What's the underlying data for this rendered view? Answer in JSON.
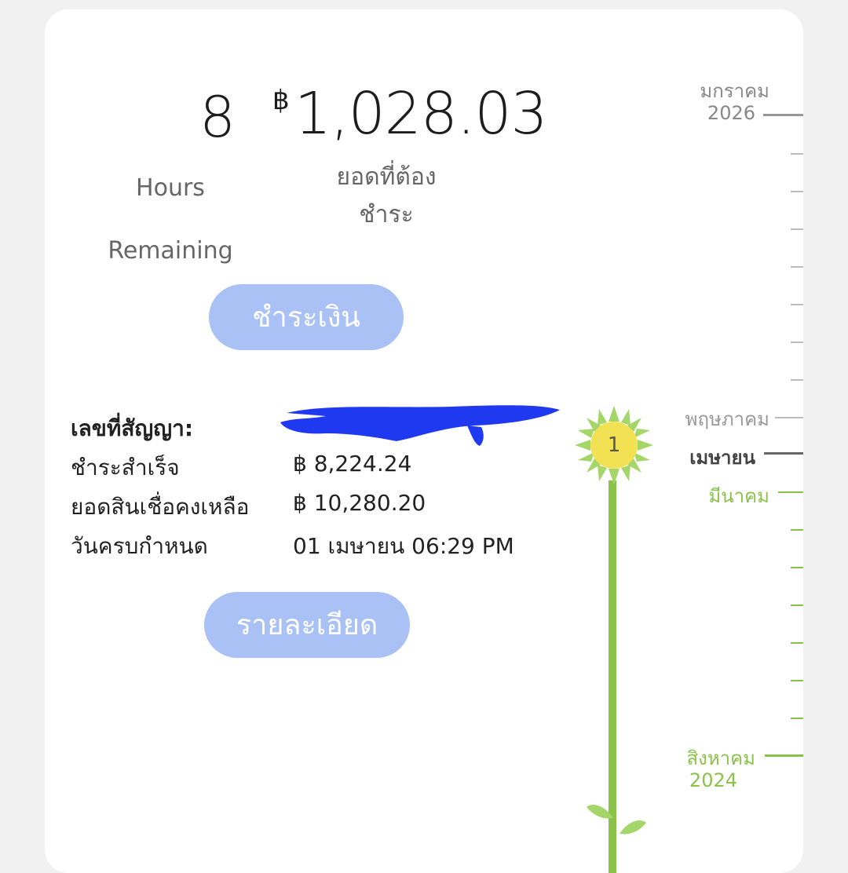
{
  "countdown": {
    "value": "8",
    "label": "Hours\nRemaining"
  },
  "due": {
    "currency": "฿",
    "amount": "1,028.03",
    "label": "ยอดที่ต้อง\nชำระ"
  },
  "buttons": {
    "pay": "ชำระเงิน",
    "details": "รายละเอียด"
  },
  "info": {
    "contract_label": "เลขที่สัญญา:",
    "paid_label": "ชำระสำเร็จ",
    "paid_value": "฿ 8,224.24",
    "remaining_label": "ยอดสินเชื่อคงเหลือ",
    "remaining_value": "฿ 10,280.20",
    "due_date_label": "วันครบกำหนด",
    "due_date_value": "01 เมษายน 06:29 PM"
  },
  "timeline": {
    "top_month": "มกราคม",
    "top_year": "2026",
    "may": "พฤษภาคม",
    "april": "เมษายน",
    "march": "มีนาคม",
    "bottom_month": "สิงหาคม",
    "bottom_year": "2024",
    "flower_count": "1"
  },
  "colors": {
    "accent": "#a9c1f5",
    "green": "#8bc34a",
    "redaction": "#1f39f0"
  }
}
